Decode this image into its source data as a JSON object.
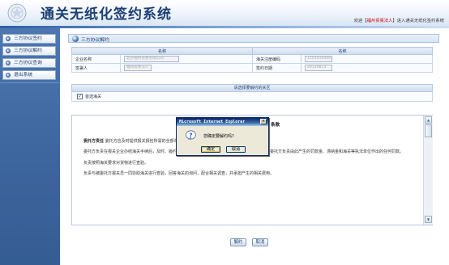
{
  "header": {
    "system_title": "通关无纸化签约系统",
    "welcome_prefix": "欢迎【",
    "user_name": "福州贸易法人",
    "welcome_suffix": "】进入通关无纸化签约系统"
  },
  "sidebar": {
    "items": [
      {
        "label": "三方协议签约"
      },
      {
        "label": "三方协议解约"
      },
      {
        "label": "三方协议查询"
      },
      {
        "label": "退出系统"
      }
    ]
  },
  "main": {
    "breadcrumb": "三方协议解约",
    "info_table": {
      "headers": [
        "名称",
        "名称"
      ],
      "rows": [
        {
          "label1": "企业名称",
          "value1": "北京福州贸易有限公司",
          "label2": "海关注册编码",
          "value2": "1101010000"
        },
        {
          "label1": "签署人",
          "value1": "福州贸易法人",
          "label2": "签约日期",
          "value2": "20120813"
        }
      ]
    },
    "choose_title": "请选择要解约的关区",
    "customs_option": "首选海关",
    "customs_checked": true,
    "terms": {
      "title": "条款",
      "lines": [
        {
          "bold": "委托方责任",
          "text": "委托方应及时提供报关报检所需的全部单证，并对单证的真实性、准确性和完整性负责。"
        },
        {
          "bold": "",
          "text": "委托方负责在报关企业办结海关手续后，及时、履约支付代理报关费用，以及海关已经认可的应付税费。委托方负责由此产生的罚款金、滞纳金和海关等执法单位作出的任何罚款。"
        },
        {
          "bold": "",
          "text": "负责按照海关要求对货物进行查验。"
        },
        {
          "bold": "",
          "text": "负责与被委托方报关员一同协助海关进行查验，回答海关的询问，配合相关调查，并承担产生的相关费用。"
        }
      ]
    },
    "buttons": {
      "unsign": "解约",
      "cancel": "取消"
    }
  },
  "dialog": {
    "title": "Microsoft Internet Explorer",
    "message": "您确定要解约吗?",
    "ok": "确定",
    "cancel": "取消",
    "close": "×"
  }
}
